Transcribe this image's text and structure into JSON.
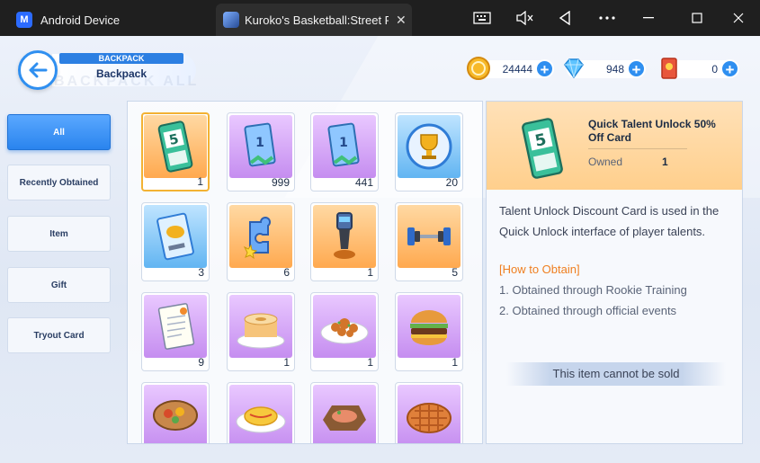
{
  "window": {
    "tab1_title": "Android Device",
    "tab2_title": "Kuroko's Basketball:Street Riva",
    "tab_close": "✕"
  },
  "header": {
    "top_label": "BACKPACK",
    "title": "Backpack",
    "shadow_text": "BACKPACK ALL"
  },
  "currencies": [
    {
      "name": "coin-icon",
      "value": "24444"
    },
    {
      "name": "diamond-icon",
      "value": "948"
    },
    {
      "name": "ticket-icon",
      "value": "0"
    }
  ],
  "sidebar": {
    "items": [
      {
        "label": "All",
        "active": true
      },
      {
        "label": "Recently Obtained",
        "active": false
      },
      {
        "label": "Item",
        "active": false
      },
      {
        "label": "Gift",
        "active": false
      },
      {
        "label": "Tryout Card",
        "active": false
      }
    ]
  },
  "grid": {
    "items": [
      {
        "name": "talent-unlock-card",
        "qty": "1",
        "bg": "orange",
        "selected": true
      },
      {
        "name": "purple-ticket-card",
        "qty": "999",
        "bg": "purple"
      },
      {
        "name": "purple-ticket-card-b",
        "qty": "441",
        "bg": "purple"
      },
      {
        "name": "trophy",
        "qty": "20",
        "bg": "blue"
      },
      {
        "name": "blue-card",
        "qty": "3",
        "bg": "blue"
      },
      {
        "name": "puzzle-piece",
        "qty": "6",
        "bg": "orange"
      },
      {
        "name": "trophy-cup-black",
        "qty": "1",
        "bg": "orange"
      },
      {
        "name": "dumbbell",
        "qty": "5",
        "bg": "orange"
      },
      {
        "name": "training-notes",
        "qty": "9",
        "bg": "purple"
      },
      {
        "name": "sponge-cake",
        "qty": "1",
        "bg": "purple"
      },
      {
        "name": "fried-dish",
        "qty": "1",
        "bg": "purple"
      },
      {
        "name": "hamburger",
        "qty": "1",
        "bg": "purple"
      },
      {
        "name": "stew-bowl",
        "qty": "",
        "bg": "purple"
      },
      {
        "name": "omelette-rice",
        "qty": "",
        "bg": "purple"
      },
      {
        "name": "fish-plate",
        "qty": "",
        "bg": "purple"
      },
      {
        "name": "pie",
        "qty": "",
        "bg": "purple"
      }
    ]
  },
  "detail": {
    "name": "Quick Talent Unlock 50% Off Card",
    "owned_label": "Owned",
    "owned_value": "1",
    "description": "Talent Unlock Discount Card is used in the Quick Unlock interface of player talents.",
    "how_to_obtain": "[How to Obtain]",
    "obtain_1": "1. Obtained through Rookie Training",
    "obtain_2": "2. Obtained through official events",
    "cannot_sell": "This item cannot be sold"
  },
  "colors": {
    "accent": "#2f8ff0",
    "selected_border": "#f3b233",
    "obtain_orange": "#ef7f20"
  }
}
